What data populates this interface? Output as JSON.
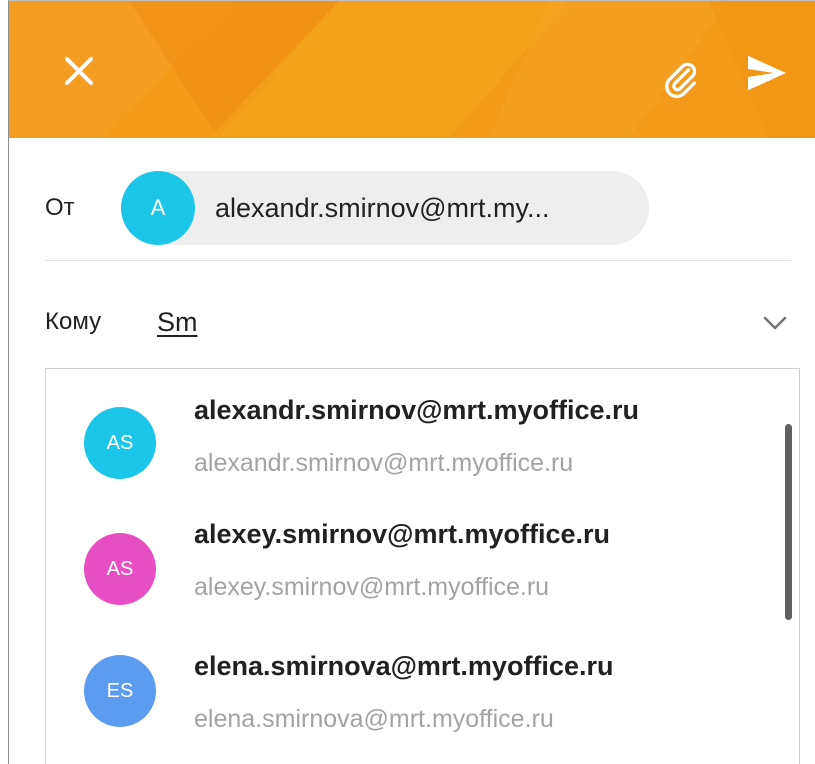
{
  "header": {
    "close_icon": "close-icon",
    "attach_icon": "paperclip-icon",
    "send_icon": "send-icon",
    "accent_color": "#F39A1A"
  },
  "from": {
    "label": "От",
    "avatar_letter": "A",
    "avatar_color": "#1BC6E8",
    "address": "alexandr.smirnov@mrt.my..."
  },
  "to": {
    "label": "Кому",
    "value": "Sm",
    "chevron_icon": "chevron-down-icon"
  },
  "suggestions": [
    {
      "initials": "AS",
      "color": "#1BC6E8",
      "name": "alexandr.smirnov@mrt.myoffice.ru",
      "email": "alexandr.smirnov@mrt.myoffice.ru"
    },
    {
      "initials": "AS",
      "color": "#E84EC3",
      "name": "alexey.smirnov@mrt.myoffice.ru",
      "email": "alexey.smirnov@mrt.myoffice.ru"
    },
    {
      "initials": "ES",
      "color": "#5B9BF0",
      "name": "elena.smirnova@mrt.myoffice.ru",
      "email": "elena.smirnova@mrt.myoffice.ru"
    }
  ]
}
